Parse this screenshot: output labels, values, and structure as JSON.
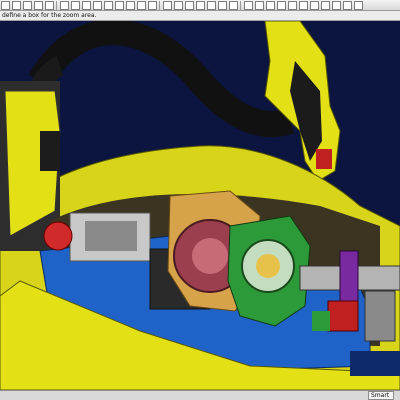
{
  "toolbar": {
    "icons": [
      "select-arrow-icon",
      "zoom-window-icon",
      "pan-icon",
      "rotate-icon",
      "fit-all-icon",
      "view-front-icon",
      "view-top-icon",
      "view-right-icon",
      "view-iso-icon",
      "shading-icon",
      "wireframe-icon",
      "section-icon",
      "measure-icon",
      "hide-icon",
      "show-icon",
      "zoom-in-icon",
      "zoom-out-icon",
      "zoom-box-icon",
      "refresh-icon",
      "layer-icon",
      "grid-icon",
      "snap-icon",
      "point-icon",
      "line-icon",
      "polyline-icon",
      "spline-icon",
      "curve-icon",
      "circle-icon",
      "arc-icon",
      "scale-icon",
      "edit-icon",
      "help-icon"
    ]
  },
  "prompt": {
    "text": "define a box for the zoom area."
  },
  "status": {
    "mode": "Smart"
  },
  "colors": {
    "background": "#0b1540",
    "yellow": "#e3e016",
    "blue": "#1f63c9",
    "maroon": "#9b3f4f",
    "green": "#2d9a3a"
  }
}
